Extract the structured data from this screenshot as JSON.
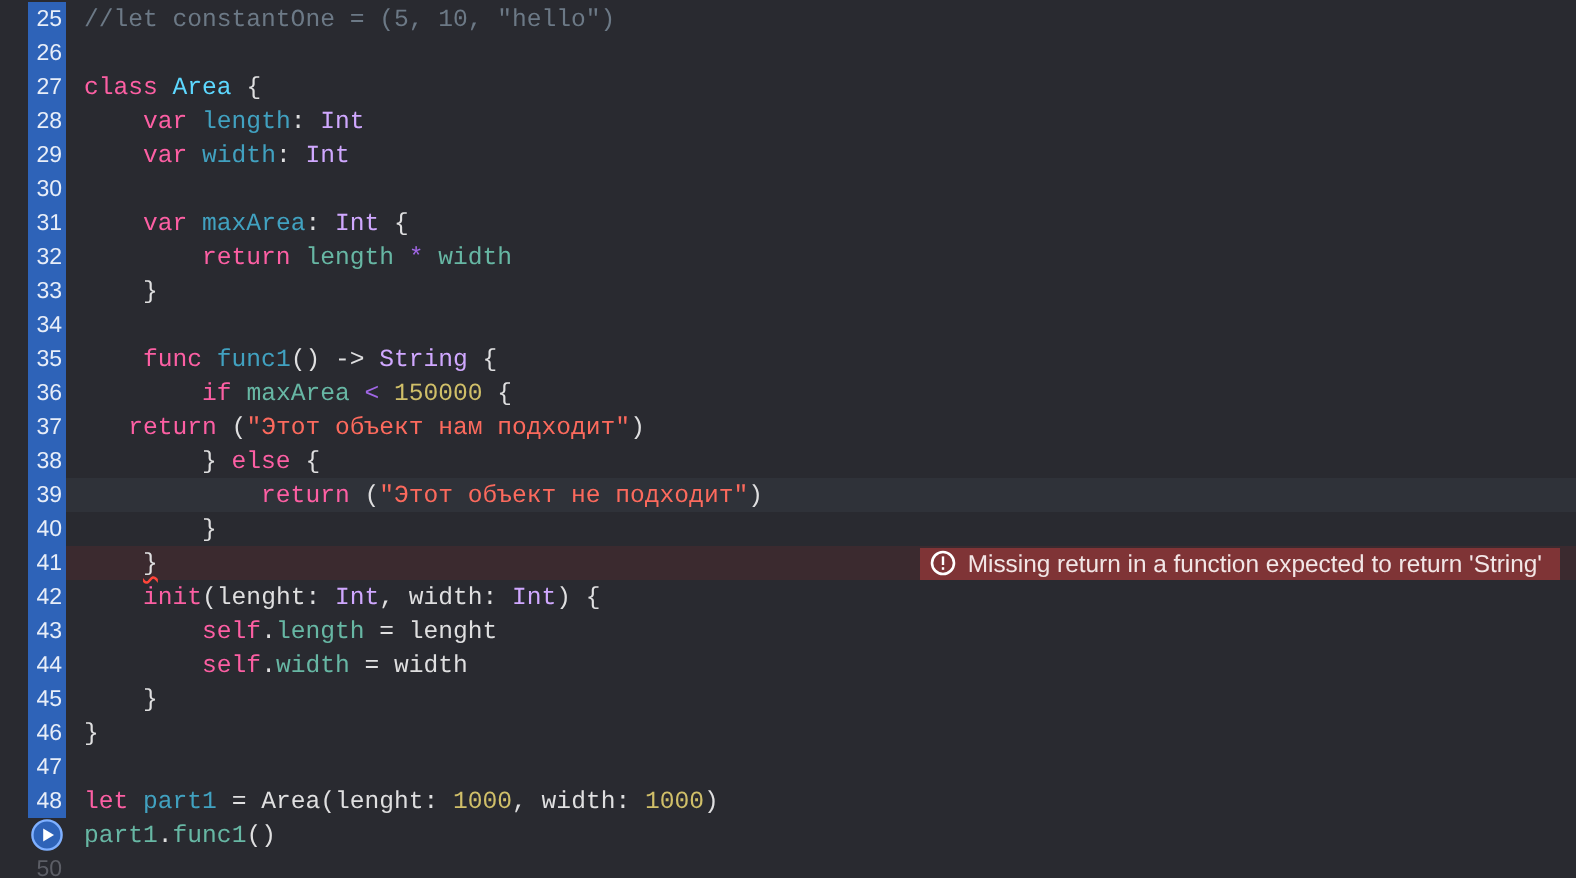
{
  "editor": {
    "lines": [
      {
        "number": "25",
        "kind": "marked",
        "tokens": [
          {
            "kind": "comment",
            "text": "//let constantOne = (5, 10, \"hello\")"
          }
        ]
      },
      {
        "number": "26",
        "kind": "marked"
      },
      {
        "number": "27",
        "kind": "marked",
        "tokens": [
          {
            "kind": "keyword",
            "text": "class "
          },
          {
            "kind": "type_decl",
            "text": "Area"
          },
          {
            "kind": "plain",
            "text": " {"
          }
        ]
      },
      {
        "number": "28",
        "kind": "marked",
        "tokens": [
          {
            "kind": "keyword",
            "text": "    var "
          },
          {
            "kind": "decl",
            "text": "length"
          },
          {
            "kind": "plain",
            "text": ": "
          },
          {
            "kind": "type",
            "text": "Int"
          }
        ]
      },
      {
        "number": "29",
        "kind": "marked",
        "tokens": [
          {
            "kind": "keyword",
            "text": "    var "
          },
          {
            "kind": "decl",
            "text": "width"
          },
          {
            "kind": "plain",
            "text": ": "
          },
          {
            "kind": "type",
            "text": "Int"
          }
        ]
      },
      {
        "number": "30",
        "kind": "marked"
      },
      {
        "number": "31",
        "kind": "marked",
        "tokens": [
          {
            "kind": "keyword",
            "text": "    var "
          },
          {
            "kind": "decl",
            "text": "maxArea"
          },
          {
            "kind": "plain",
            "text": ": "
          },
          {
            "kind": "type",
            "text": "Int"
          },
          {
            "kind": "plain",
            "text": " {"
          }
        ]
      },
      {
        "number": "32",
        "kind": "marked",
        "tokens": [
          {
            "kind": "keyword",
            "text": "        return "
          },
          {
            "kind": "ident",
            "text": "length "
          },
          {
            "kind": "operator",
            "text": "* "
          },
          {
            "kind": "ident",
            "text": "width"
          }
        ]
      },
      {
        "number": "33",
        "kind": "marked",
        "tokens": [
          {
            "kind": "plain",
            "text": "    }"
          }
        ]
      },
      {
        "number": "34",
        "kind": "marked"
      },
      {
        "number": "35",
        "kind": "marked",
        "tokens": [
          {
            "kind": "keyword",
            "text": "    func "
          },
          {
            "kind": "decl",
            "text": "func1"
          },
          {
            "kind": "plain",
            "text": "() -> "
          },
          {
            "kind": "type",
            "text": "String"
          },
          {
            "kind": "plain",
            "text": " {"
          }
        ]
      },
      {
        "number": "36",
        "kind": "marked",
        "tokens": [
          {
            "kind": "keyword",
            "text": "        if "
          },
          {
            "kind": "ident",
            "text": "maxArea "
          },
          {
            "kind": "operator",
            "text": "< "
          },
          {
            "kind": "number",
            "text": "150000"
          },
          {
            "kind": "plain",
            "text": " {"
          }
        ]
      },
      {
        "number": "37",
        "kind": "marked",
        "tokens": [
          {
            "kind": "keyword",
            "text": "   return"
          },
          {
            "kind": "plain",
            "text": " ("
          },
          {
            "kind": "string",
            "text": "\"Этот объект нам подходит\""
          },
          {
            "kind": "plain",
            "text": ")"
          }
        ]
      },
      {
        "number": "38",
        "kind": "marked",
        "tokens": [
          {
            "kind": "plain",
            "text": "        } "
          },
          {
            "kind": "keyword",
            "text": "else"
          },
          {
            "kind": "plain",
            "text": " {"
          }
        ]
      },
      {
        "number": "39",
        "kind": "marked",
        "highlighted": true,
        "tokens": [
          {
            "kind": "keyword",
            "text": "            return"
          },
          {
            "kind": "plain",
            "text": " ("
          },
          {
            "kind": "string",
            "text": "\"Этот объект не подходит\""
          },
          {
            "kind": "plain",
            "text": ")"
          }
        ]
      },
      {
        "number": "40",
        "kind": "marked",
        "tokens": [
          {
            "kind": "plain",
            "text": "        }"
          }
        ]
      },
      {
        "number": "41",
        "kind": "marked",
        "error": "Missing return in a function expected to return 'String'",
        "tokens": [
          {
            "kind": "plain",
            "text": "    }",
            "squiggle": true
          }
        ]
      },
      {
        "number": "42",
        "kind": "marked",
        "tokens": [
          {
            "kind": "keyword",
            "text": "    init"
          },
          {
            "kind": "plain",
            "text": "(lenght: "
          },
          {
            "kind": "type",
            "text": "Int"
          },
          {
            "kind": "plain",
            "text": ", width: "
          },
          {
            "kind": "type",
            "text": "Int"
          },
          {
            "kind": "plain",
            "text": ") {"
          }
        ]
      },
      {
        "number": "43",
        "kind": "marked",
        "tokens": [
          {
            "kind": "keyword",
            "text": "        self"
          },
          {
            "kind": "plain",
            "text": "."
          },
          {
            "kind": "ident",
            "text": "length"
          },
          {
            "kind": "plain",
            "text": " = lenght"
          }
        ]
      },
      {
        "number": "44",
        "kind": "marked",
        "tokens": [
          {
            "kind": "keyword",
            "text": "        self"
          },
          {
            "kind": "plain",
            "text": "."
          },
          {
            "kind": "ident",
            "text": "width"
          },
          {
            "kind": "plain",
            "text": " = width"
          }
        ]
      },
      {
        "number": "45",
        "kind": "marked",
        "tokens": [
          {
            "kind": "plain",
            "text": "    }"
          }
        ]
      },
      {
        "number": "46",
        "kind": "marked",
        "tokens": [
          {
            "kind": "plain",
            "text": "}"
          }
        ]
      },
      {
        "number": "47",
        "kind": "marked"
      },
      {
        "number": "48",
        "kind": "marked",
        "tokens": [
          {
            "kind": "keyword",
            "text": "let "
          },
          {
            "kind": "decl",
            "text": "part1"
          },
          {
            "kind": "plain",
            "text": " = Area(lenght: "
          },
          {
            "kind": "number",
            "text": "1000"
          },
          {
            "kind": "plain",
            "text": ", width: "
          },
          {
            "kind": "number",
            "text": "1000"
          },
          {
            "kind": "plain",
            "text": ")"
          }
        ]
      },
      {
        "kind": "run",
        "tokens": [
          {
            "kind": "ident",
            "text": "part1"
          },
          {
            "kind": "plain",
            "text": "."
          },
          {
            "kind": "ident",
            "text": "func1"
          },
          {
            "kind": "plain",
            "text": "()"
          }
        ]
      },
      {
        "number": "50",
        "kind": "plain"
      }
    ]
  }
}
